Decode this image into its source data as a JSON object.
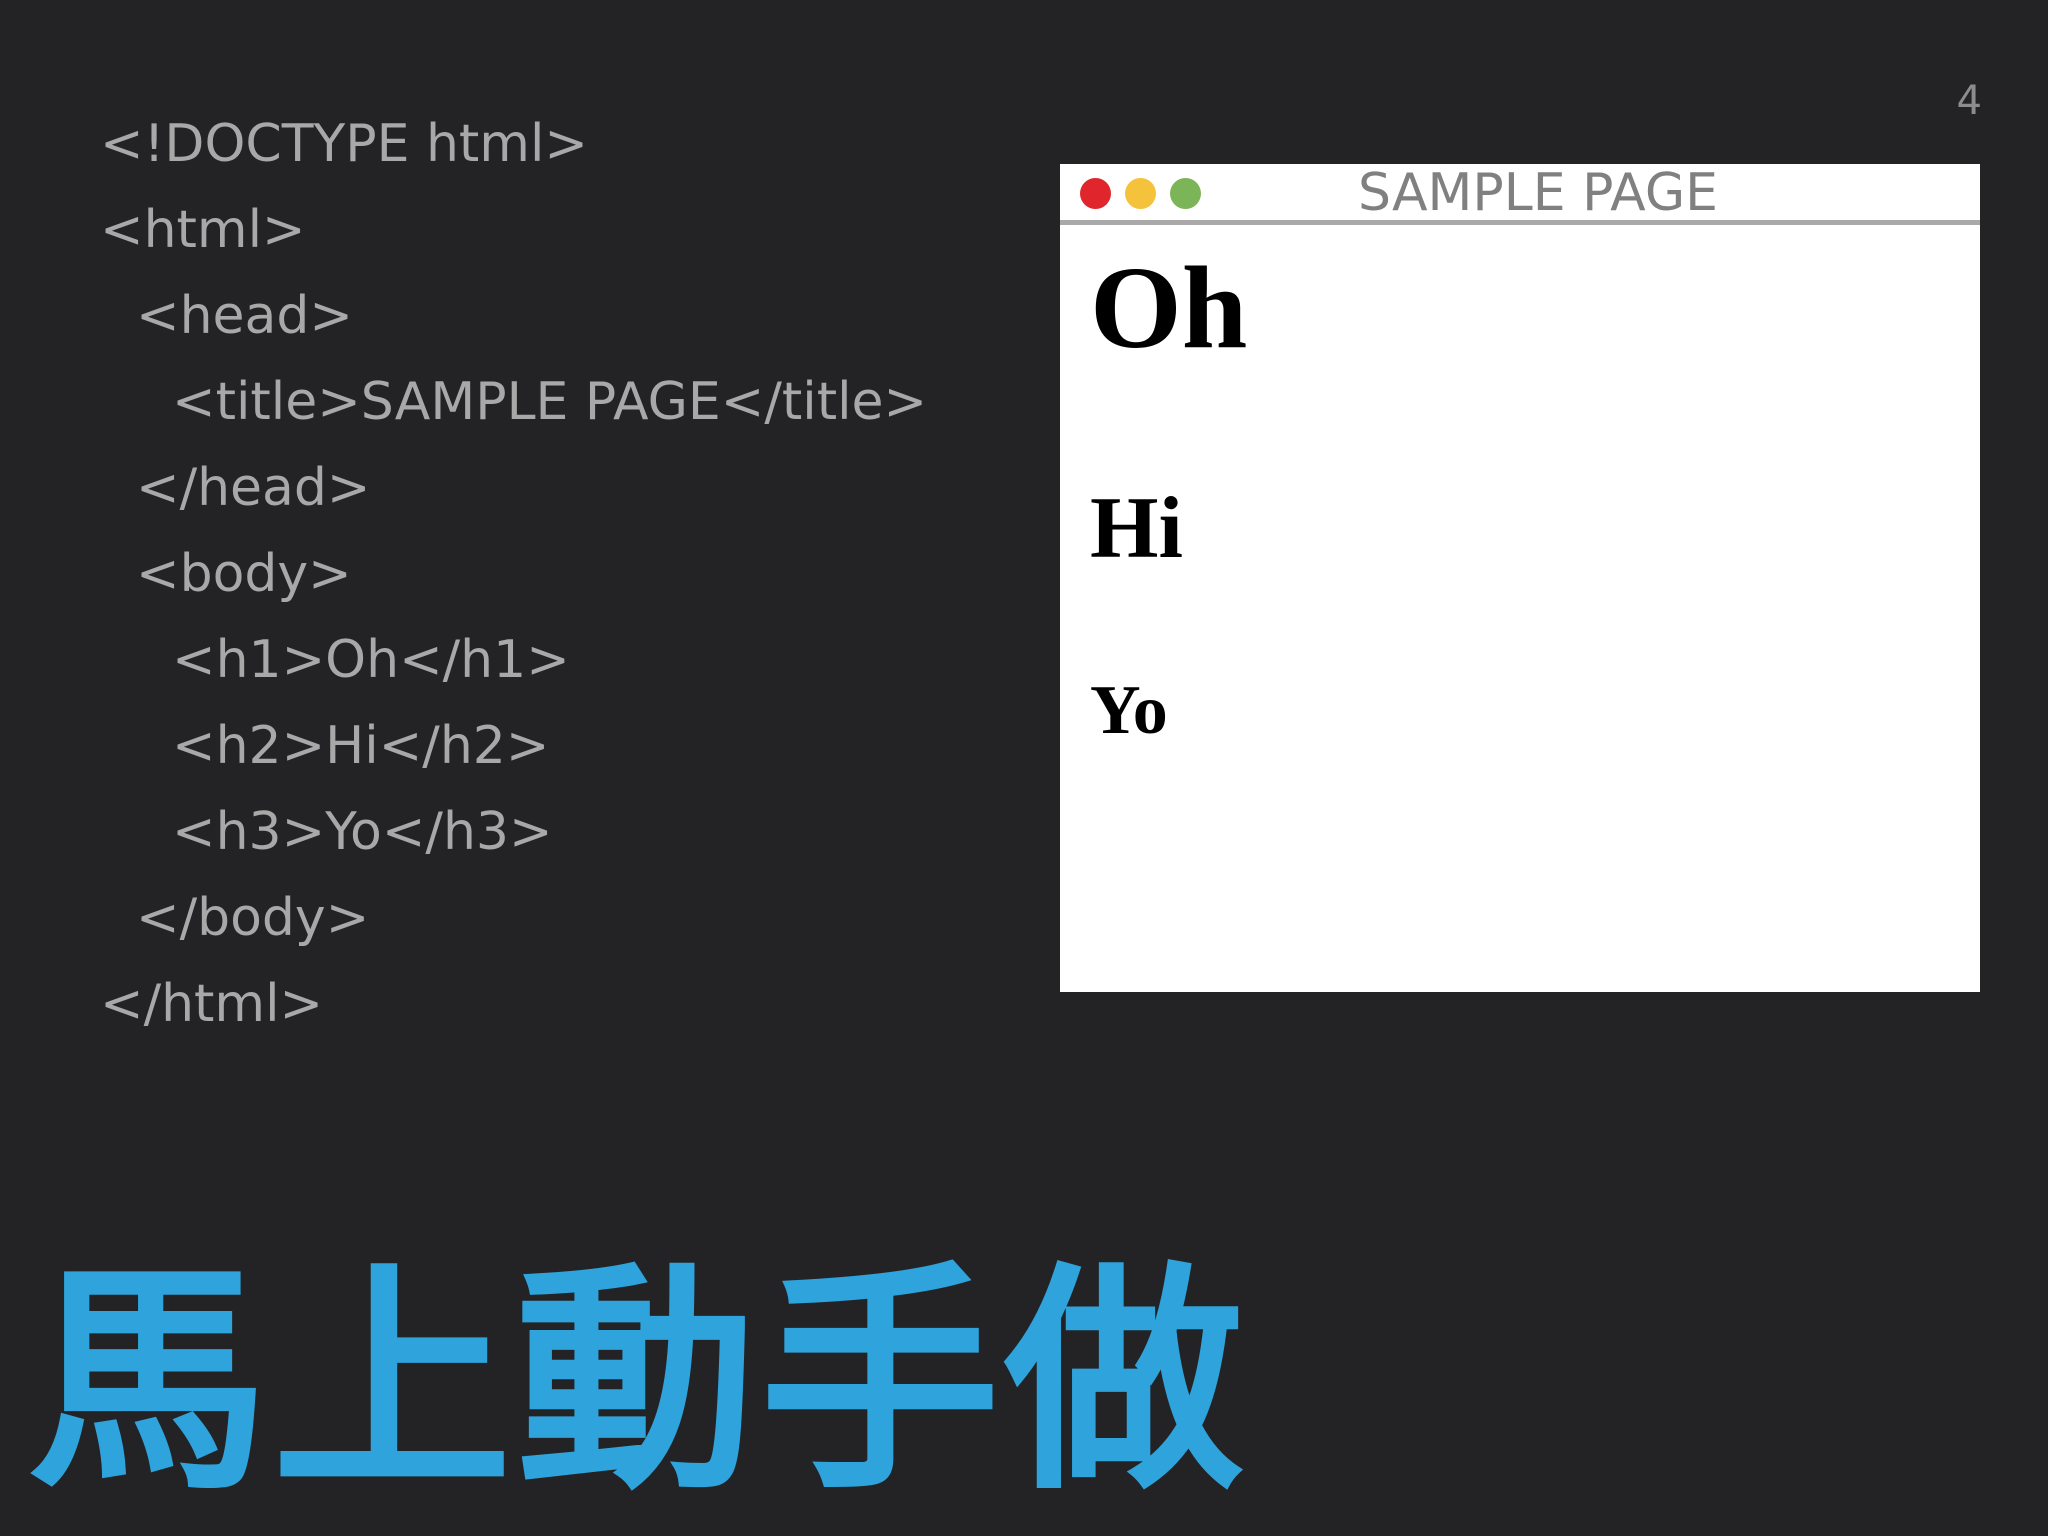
{
  "slide": {
    "number": "4",
    "code_lines": [
      {
        "text": "<!DOCTYPE html>",
        "indent": 0
      },
      {
        "text": "<html>",
        "indent": 0
      },
      {
        "text": "<head>",
        "indent": 1
      },
      {
        "text": "<title>SAMPLE PAGE</title>",
        "indent": 2
      },
      {
        "text": "</head>",
        "indent": 1
      },
      {
        "text": "<body>",
        "indent": 1
      },
      {
        "text": "<h1>Oh</h1>",
        "indent": 2
      },
      {
        "text": "<h2>Hi</h2>",
        "indent": 2
      },
      {
        "text": "<h3>Yo</h3>",
        "indent": 2
      },
      {
        "text": "</body>",
        "indent": 1
      },
      {
        "text": "</html>",
        "indent": 0
      }
    ],
    "cta": "馬上動手做",
    "cta_color": "#2ea3dc"
  },
  "browser": {
    "title": "SAMPLE PAGE",
    "traffic_lights": [
      "#e0262c",
      "#f5c23b",
      "#7cb558"
    ],
    "content": {
      "h1": "Oh",
      "h2": "Hi",
      "h3": "Yo"
    }
  }
}
